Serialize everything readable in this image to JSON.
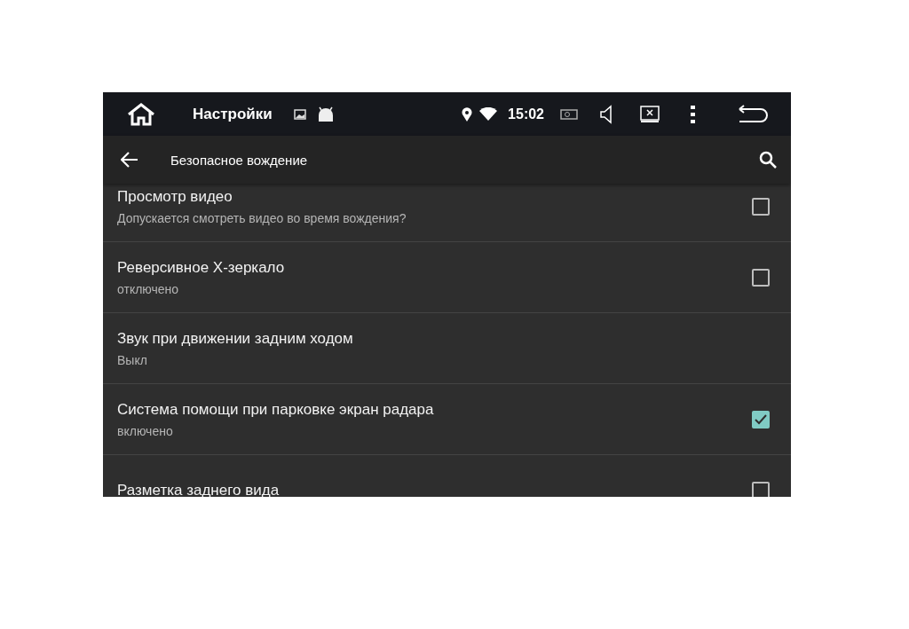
{
  "status_bar": {
    "title": "Настройки",
    "time": "15:02"
  },
  "toolbar": {
    "title": "Безопасное вождение"
  },
  "settings": [
    {
      "kind": "checkbox",
      "title": "Просмотр видео",
      "summary": "Допускается смотреть видео во время вождения?",
      "checked": false
    },
    {
      "kind": "checkbox",
      "title": "Реверсивное Х-зеркало",
      "summary": "отключено",
      "checked": false
    },
    {
      "kind": "text",
      "title": "Звук при движении задним ходом",
      "summary": "Выкл"
    },
    {
      "kind": "checkbox",
      "title": "Система помощи при парковке экран радара",
      "summary": "включено",
      "checked": true
    },
    {
      "kind": "checkbox",
      "title": "Разметка заднего вида",
      "checked": false
    }
  ]
}
